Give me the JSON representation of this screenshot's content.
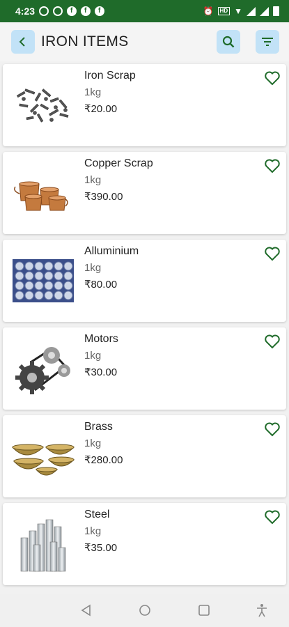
{
  "status_bar": {
    "time": "4:23"
  },
  "header": {
    "title": "IRON ITEMS",
    "accent_color": "#1f6b2a",
    "button_bg": "#c2e2f7"
  },
  "items": [
    {
      "name": "Iron Scrap",
      "weight": "1kg",
      "price": "₹20.00",
      "image": "screws-icon"
    },
    {
      "name": "Copper Scrap",
      "weight": "1kg",
      "price": "₹390.00",
      "image": "copper-pots-icon"
    },
    {
      "name": "Alluminium",
      "weight": "1kg",
      "price": "₹80.00",
      "image": "aluminium-cans-icon"
    },
    {
      "name": "Motors",
      "weight": "1kg",
      "price": "₹30.00",
      "image": "gears-icon"
    },
    {
      "name": "Brass",
      "weight": "1kg",
      "price": "₹280.00",
      "image": "brass-bowls-icon"
    },
    {
      "name": "Steel",
      "weight": "1kg",
      "price": "₹35.00",
      "image": "steel-pipes-icon"
    }
  ]
}
